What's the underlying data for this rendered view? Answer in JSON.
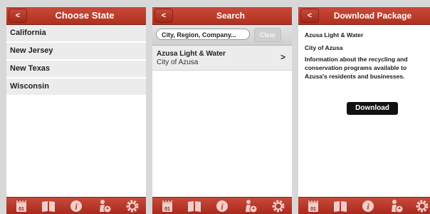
{
  "colors": {
    "accent": "#b53524",
    "tab_icon": "#f0cfca",
    "list_row": "#ececec"
  },
  "screens": [
    {
      "back_label": "<",
      "title": "Choose State",
      "states": [
        "California",
        "New Jersey",
        "New Texas",
        "Wisconsin"
      ]
    },
    {
      "back_label": "<",
      "title": "Search",
      "search_placeholder": "City, Region, Company...",
      "clear_label": "Clear",
      "result": {
        "name": "Azusa Light & Water",
        "city": "City of Azusa",
        "chevron": ">"
      }
    },
    {
      "back_label": "<",
      "title": "Download Package",
      "package_name": "Azusa Light & Water",
      "package_city": "City of Azusa",
      "package_description": "Information about the recycling and conservation programs available to Azusa's residents and businesses.",
      "download_label": "Download"
    }
  ],
  "tabbar": {
    "calendar_day": "01",
    "icons": [
      "calendar-icon",
      "book-icon",
      "info-icon",
      "recycle-person-icon",
      "settings-icon"
    ]
  }
}
